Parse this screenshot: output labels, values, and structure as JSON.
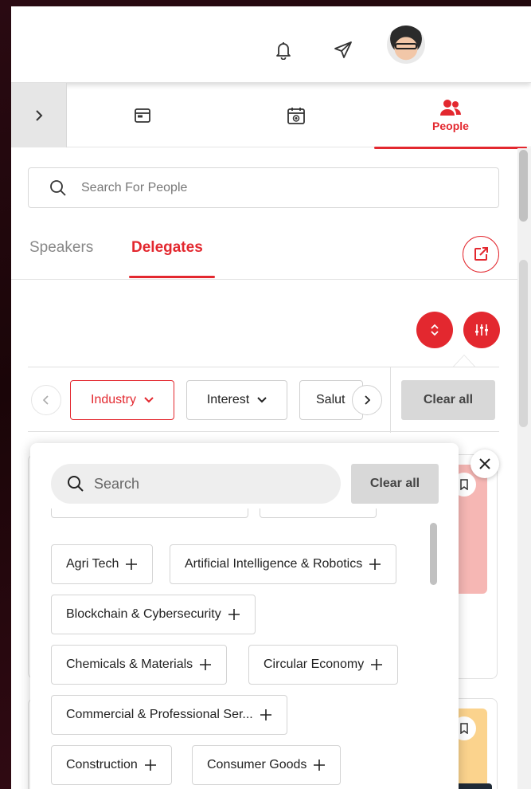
{
  "colors": {
    "accent": "#e3282f",
    "accent_light": "#f6b7b4",
    "accent_yellow": "#fbd38d"
  },
  "header": {
    "icons": [
      "bell-icon",
      "send-icon",
      "avatar"
    ]
  },
  "main_tabs": [
    {
      "icon": "browser-window-icon",
      "label": ""
    },
    {
      "icon": "calendar-live-icon",
      "label": ""
    },
    {
      "icon": "people-icon",
      "label": "People",
      "active": true
    }
  ],
  "search": {
    "placeholder": "Search For People"
  },
  "sub_tabs": [
    {
      "label": "Speakers",
      "active": false
    },
    {
      "label": "Delegates",
      "active": true
    }
  ],
  "filters": {
    "chips": [
      {
        "label": "Industry",
        "active": true
      },
      {
        "label": "Interest",
        "active": false
      },
      {
        "label": "Salut",
        "active": false
      }
    ],
    "clear_label": "Clear all"
  },
  "popover": {
    "search_placeholder": "Search",
    "clear_label": "Clear all",
    "tags": [
      "Agri Tech",
      "Artificial Intelligence & Robotics",
      "Blockchain & Cybersecurity",
      "Chemicals & Materials",
      "Circular Economy",
      "Commercial & Professional Ser...",
      "Construction",
      "Consumer Goods"
    ]
  }
}
